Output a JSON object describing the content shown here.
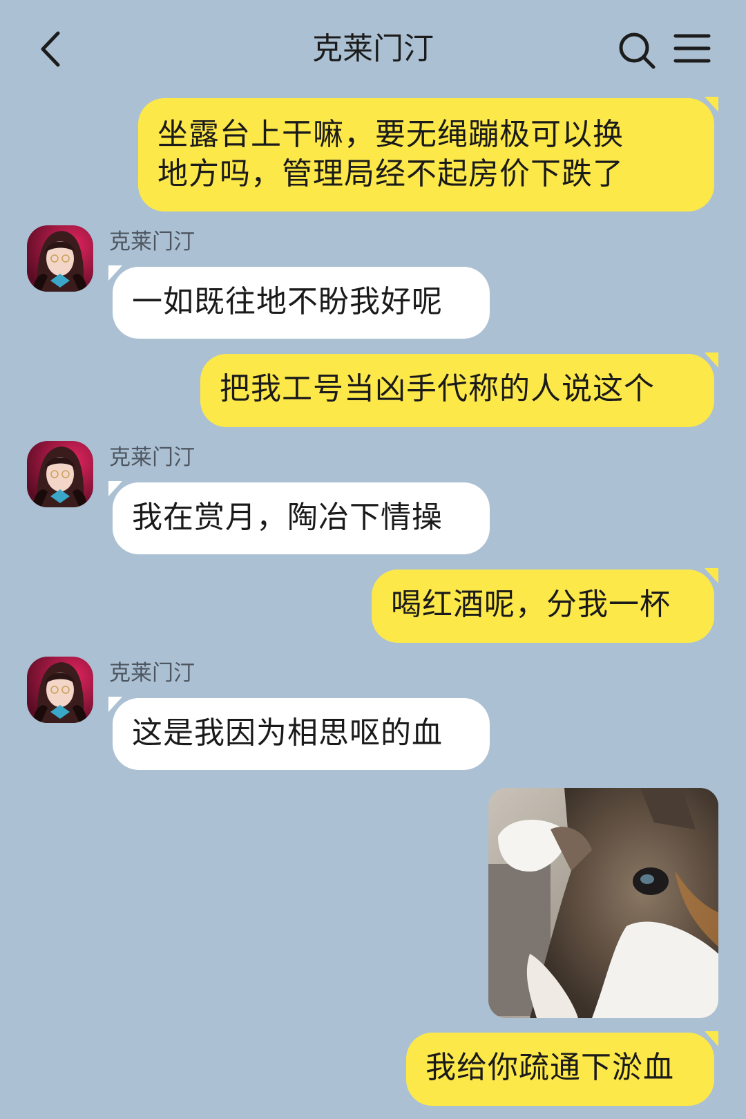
{
  "header": {
    "title": "克莱门汀",
    "back_icon": "chevron-left-icon",
    "search_icon": "search-icon",
    "menu_icon": "hamburger-menu-icon"
  },
  "contact": {
    "name": "克莱门汀"
  },
  "messages": [
    {
      "direction": "sent",
      "text_lines": [
        "坐露台上干嘛，要无绳蹦极可以换",
        "地方吗，管理局经不起房价下跌了"
      ]
    },
    {
      "direction": "received",
      "sender": "克莱门汀",
      "text": "一如既往地不盼我好呢"
    },
    {
      "direction": "sent",
      "text": "把我工号当凶手代称的人说这个"
    },
    {
      "direction": "received",
      "sender": "克莱门汀",
      "text": "我在赏月，陶冶下情操"
    },
    {
      "direction": "sent",
      "text": "喝红酒呢，分我一杯"
    },
    {
      "direction": "received",
      "sender": "克莱门汀",
      "text": "这是我因为相思呕的血"
    },
    {
      "direction": "sent",
      "type": "image",
      "image": "cat-photo"
    },
    {
      "direction": "sent",
      "text": "我给你疏通下淤血"
    }
  ],
  "colors": {
    "background": "#abc1d3",
    "sent_bubble": "#fde84a",
    "received_bubble": "#ffffff"
  }
}
